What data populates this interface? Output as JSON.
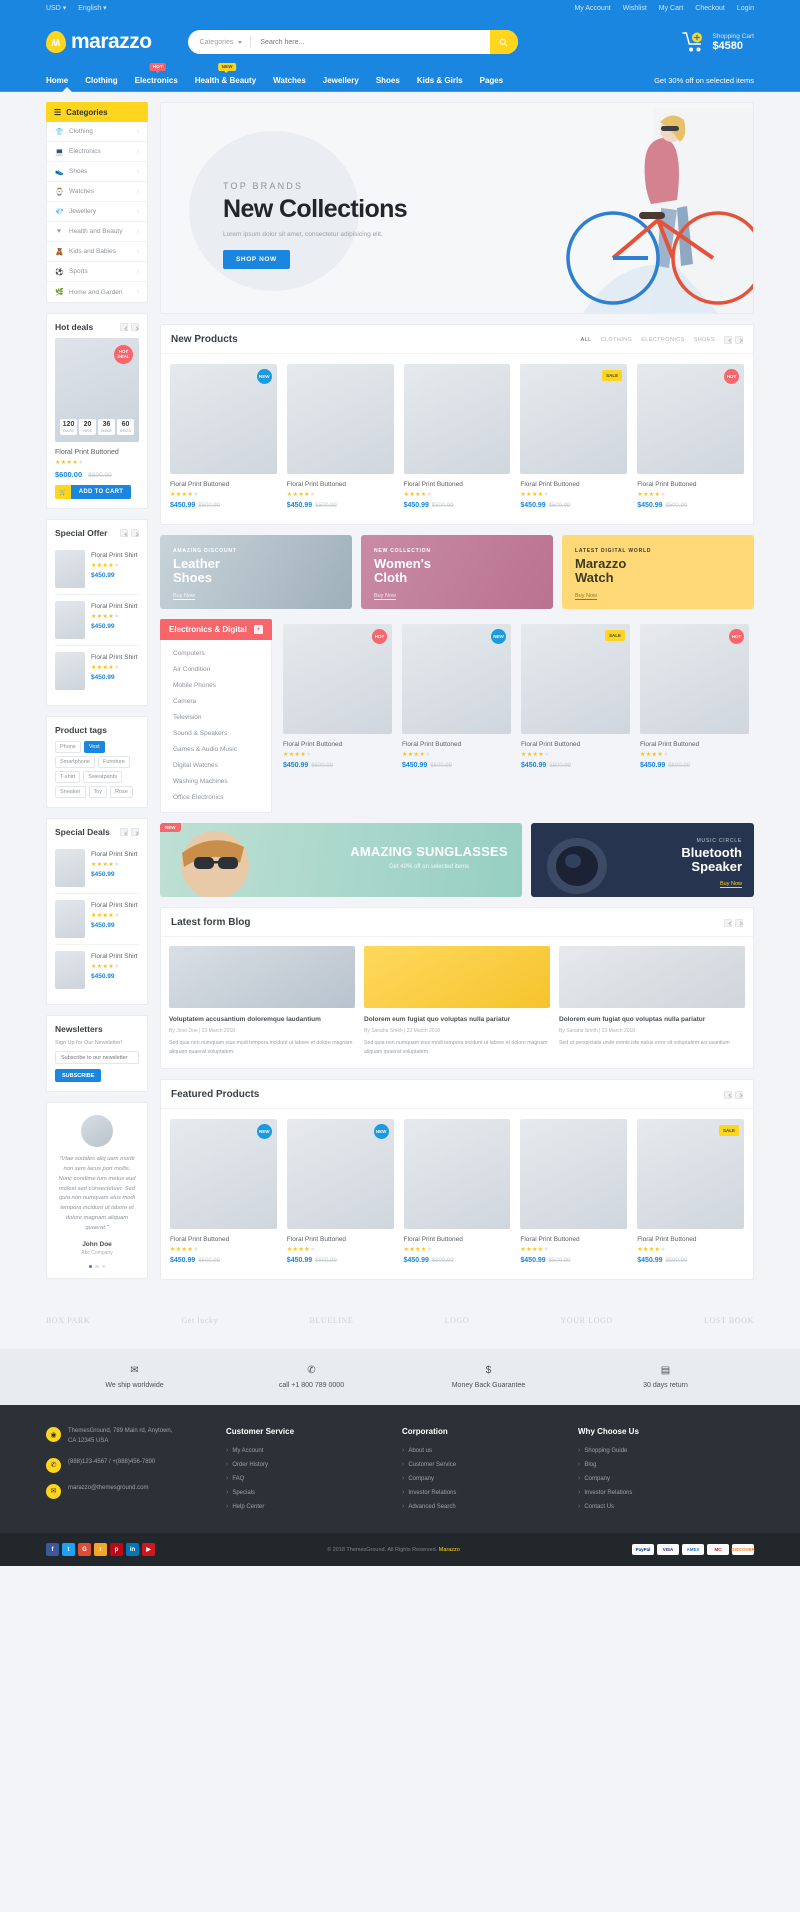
{
  "topbar": {
    "currency": "USD",
    "language": "English",
    "links": [
      "My Account",
      "Wishlist",
      "My Cart",
      "Checkout",
      "Login"
    ]
  },
  "header": {
    "brand": "marazzo",
    "search": {
      "category": "Categories",
      "placeholder": "Search here...",
      "value": ""
    },
    "cart": {
      "label": "Shopping Cart",
      "total": "$4580"
    }
  },
  "nav": {
    "items": [
      {
        "label": "Home",
        "badge": ""
      },
      {
        "label": "Clothing",
        "badge": ""
      },
      {
        "label": "Electronics",
        "badge": "HOT"
      },
      {
        "label": "Health & Beauty",
        "badge": "NEW"
      },
      {
        "label": "Watches",
        "badge": ""
      },
      {
        "label": "Jewellery",
        "badge": ""
      },
      {
        "label": "Shoes",
        "badge": ""
      },
      {
        "label": "Kids & Girls",
        "badge": ""
      },
      {
        "label": "Pages",
        "badge": ""
      }
    ],
    "promo": "Get 30% off on selected items"
  },
  "categories": {
    "title": "Categories",
    "items": [
      {
        "label": "Clothing",
        "icon": "shirt-icon"
      },
      {
        "label": "Electronics",
        "icon": "laptop-icon"
      },
      {
        "label": "Shoes",
        "icon": "shoe-icon"
      },
      {
        "label": "Watches",
        "icon": "watch-icon"
      },
      {
        "label": "Jewellery",
        "icon": "diamond-icon"
      },
      {
        "label": "Health and Beauty",
        "icon": "heart-icon"
      },
      {
        "label": "Kids and Babies",
        "icon": "kids-icon"
      },
      {
        "label": "Sports",
        "icon": "ball-icon"
      },
      {
        "label": "Home and Garden",
        "icon": "leaf-icon"
      }
    ]
  },
  "hero": {
    "kicker": "TOP BRANDS",
    "heading": "New Collections",
    "subtitle": "Lorem ipsum dolor sit amet, consectetur adipisicing elit.",
    "button": "SHOP NOW"
  },
  "hot_deals": {
    "title": "Hot deals",
    "badge_line1": "HOT",
    "badge_line2": "DEAL",
    "countdown": [
      {
        "num": "120",
        "label": "DAYS"
      },
      {
        "num": "20",
        "label": "HRS"
      },
      {
        "num": "36",
        "label": "MINS"
      },
      {
        "num": "60",
        "label": "SECS"
      }
    ],
    "product": {
      "name": "Floral Print Buttoned",
      "rating": 4,
      "price": "$600.00",
      "old_price": "$800.00"
    },
    "add_to_cart": "ADD TO CART"
  },
  "special_offer": {
    "title": "Special Offer",
    "items": [
      {
        "name": "Floral Print Shirt",
        "price": "$450.99",
        "rating": 4
      },
      {
        "name": "Floral Print Shirt",
        "price": "$450.99",
        "rating": 4
      },
      {
        "name": "Floral Print Shirt",
        "price": "$450.99",
        "rating": 4
      }
    ]
  },
  "product_tags": {
    "title": "Product tags",
    "tags": [
      {
        "label": "Phone",
        "active": false
      },
      {
        "label": "Vest",
        "active": true
      },
      {
        "label": "Smartphone",
        "active": false
      },
      {
        "label": "Furniture",
        "active": false
      },
      {
        "label": "T-shirt",
        "active": false
      },
      {
        "label": "Sweatpants",
        "active": false
      },
      {
        "label": "Sneaker",
        "active": false
      },
      {
        "label": "Toy",
        "active": false
      },
      {
        "label": "Rose",
        "active": false
      }
    ]
  },
  "special_deals": {
    "title": "Special Deals",
    "items": [
      {
        "name": "Floral Print Shirt",
        "price": "$450.99",
        "rating": 4
      },
      {
        "name": "Floral Print Shirt",
        "price": "$450.99",
        "rating": 4
      },
      {
        "name": "Floral Print Shirt",
        "price": "$450.99",
        "rating": 4
      }
    ]
  },
  "newsletter": {
    "title": "Newsletters",
    "subtitle": "Sign Up for Our Newsletter!",
    "placeholder": "Subscribe to our newsletter",
    "button": "SUBSCRIBE"
  },
  "testimonial": {
    "quote": "\"Vtae sodales aliq uam morbi non sem lacus port mollis. Nunc condime tum metus eud molest sed consectetuer. Sed quia non numquam eius modi tempora incidunt ut labore et dolore magnam aliquam quaerat.\"",
    "name": "John Doe",
    "company": "Abc Company"
  },
  "new_products": {
    "title": "New Products",
    "filters": [
      {
        "label": "ALL",
        "active": true
      },
      {
        "label": "CLOTHING",
        "active": false
      },
      {
        "label": "ELECTRONICS",
        "active": false
      },
      {
        "label": "SHOES",
        "active": false
      }
    ],
    "items": [
      {
        "name": "Floral Print Buttoned",
        "price": "$450.99",
        "old_price": "$500.99",
        "rating": 4,
        "badge": "NEW",
        "badge_type": "new"
      },
      {
        "name": "Floral Print Buttoned",
        "price": "$450.99",
        "old_price": "$500.99",
        "rating": 4,
        "badge": "",
        "badge_type": ""
      },
      {
        "name": "Floral Print Buttoned",
        "price": "$450.99",
        "old_price": "$500.99",
        "rating": 4,
        "badge": "",
        "badge_type": ""
      },
      {
        "name": "Floral Print Buttoned",
        "price": "$450.99",
        "old_price": "$500.99",
        "rating": 4,
        "badge": "SALE",
        "badge_type": "sale"
      },
      {
        "name": "Floral Print Buttoned",
        "price": "$450.99",
        "old_price": "$500.99",
        "rating": 4,
        "badge": "HOT",
        "badge_type": "hot"
      }
    ]
  },
  "promos": [
    {
      "kicker": "AMAZING DISCOUNT",
      "heading": "Leather\nShoes",
      "link": "Buy Now"
    },
    {
      "kicker": "NEW COLLECTION",
      "heading": "Women's\nCloth",
      "link": "Buy Now"
    },
    {
      "kicker": "LATEST DIGITAL WORLD",
      "heading": "Marazzo\nWatch",
      "link": "Buy Now"
    }
  ],
  "electronics": {
    "tab": "Electronics & Digital",
    "menu": [
      "Computers",
      "Air Condition",
      "Mobile Phones",
      "Camera",
      "Television",
      "Sound & Speakers",
      "Games & Audio Music",
      "Digital Watches",
      "Washing Machines",
      "Office Electronics"
    ],
    "items": [
      {
        "name": "Floral Print Buttoned",
        "price": "$450.99",
        "old_price": "$500.99",
        "rating": 4,
        "badge": "HOT",
        "badge_type": "hot"
      },
      {
        "name": "Floral Print Buttoned",
        "price": "$450.99",
        "old_price": "$500.99",
        "rating": 4,
        "badge": "NEW",
        "badge_type": "new"
      },
      {
        "name": "Floral Print Buttoned",
        "price": "$450.99",
        "old_price": "$500.99",
        "rating": 4,
        "badge": "SALE",
        "badge_type": "sale"
      },
      {
        "name": "Floral Print Buttoned",
        "price": "$450.99",
        "old_price": "$500.99",
        "rating": 4,
        "badge": "HOT",
        "badge_type": "hot"
      }
    ]
  },
  "wide_banners": {
    "left": {
      "tag": "NEW",
      "heading": "AMAZING SUNGLASSES",
      "subtitle": "Get 40% off on selected items"
    },
    "right": {
      "kicker": "MUSIC CIRCLE",
      "heading": "Bluetooth\nSpeaker",
      "link": "Buy Now"
    }
  },
  "blog": {
    "title": "Latest form Blog",
    "posts": [
      {
        "title": "Voluptatem accusantium doloremque laudantium",
        "meta": "By Jone Doe | 23 March 2018",
        "excerpt": "Sed quia non numquam eius modi tempora incidunt ut labore et dolore magnam aliquam quaerat voluptatem."
      },
      {
        "title": "Dolorem eum fugiat quo voluptas nulla pariatur",
        "meta": "By Sanaha Smith | 23 March 2018",
        "excerpt": "Sed quia non numquam eius modi tempora incidunt ut labore et dolore magnam aliquam quaerat voluptatem."
      },
      {
        "title": "Dolorem eum fugiat quo voluptas nulla pariatur",
        "meta": "By Sanaha Smith | 23 March 2018",
        "excerpt": "Sed ut perspiciatis unde omnis iste natus error sit voluptatem accusantium"
      }
    ]
  },
  "featured": {
    "title": "Featured Products",
    "items": [
      {
        "name": "Floral Print Buttoned",
        "price": "$450.99",
        "old_price": "$500.99",
        "rating": 4,
        "badge": "NEW",
        "badge_type": "new"
      },
      {
        "name": "Floral Print Buttoned",
        "price": "$450.99",
        "old_price": "$500.99",
        "rating": 4,
        "badge": "NEW",
        "badge_type": "new"
      },
      {
        "name": "Floral Print Buttoned",
        "price": "$450.99",
        "old_price": "$500.99",
        "rating": 4,
        "badge": "",
        "badge_type": ""
      },
      {
        "name": "Floral Print Buttoned",
        "price": "$450.99",
        "old_price": "$500.99",
        "rating": 4,
        "badge": "",
        "badge_type": ""
      },
      {
        "name": "Floral Print Buttoned",
        "price": "$450.99",
        "old_price": "$500.99",
        "rating": 4,
        "badge": "SALE",
        "badge_type": "sale"
      }
    ]
  },
  "brands": [
    "BOX PARK",
    "Get lucky",
    "BLUELINE",
    "LOGO",
    "YOUR LOGO",
    "LOST BOOK"
  ],
  "services": [
    {
      "icon": "truck-icon",
      "glyph": "✉",
      "text": "We ship worldwide"
    },
    {
      "icon": "phone-icon",
      "glyph": "✆",
      "text": "call +1 800 789 0000"
    },
    {
      "icon": "dollar-icon",
      "glyph": "$",
      "text": "Money Back Guarantee"
    },
    {
      "icon": "calendar-icon",
      "glyph": "▤",
      "text": "30 days return"
    }
  ],
  "footer": {
    "contact": [
      {
        "icon": "location-icon",
        "glyph": "◉",
        "text": "ThemesGround, 789 Main rd, Anytown,\nCA 12345 USA"
      },
      {
        "icon": "phone-icon",
        "glyph": "✆",
        "text": "(888)123-4567 / +(888)456-7890"
      },
      {
        "icon": "mail-icon",
        "glyph": "✉",
        "text": "marazzo@themesground.com"
      }
    ],
    "columns": [
      {
        "heading": "Customer Service",
        "links": [
          "My Account",
          "Order History",
          "FAQ",
          "Specials",
          "Help Center"
        ]
      },
      {
        "heading": "Corporation",
        "links": [
          "About us",
          "Customer Service",
          "Company",
          "Investor Relations",
          "Advanced Search"
        ]
      },
      {
        "heading": "Why Choose Us",
        "links": [
          "Shopping Guide",
          "Blog",
          "Company",
          "Investor Relations",
          "Contact Us"
        ]
      }
    ],
    "socials": [
      {
        "name": "facebook-icon",
        "glyph": "f",
        "color": "#3b5998"
      },
      {
        "name": "twitter-icon",
        "glyph": "t",
        "color": "#1da1f2"
      },
      {
        "name": "google-plus-icon",
        "glyph": "G",
        "color": "#dd4b39"
      },
      {
        "name": "rss-icon",
        "glyph": "r",
        "color": "#f5a623"
      },
      {
        "name": "pinterest-icon",
        "glyph": "p",
        "color": "#bd081c"
      },
      {
        "name": "linkedin-icon",
        "glyph": "in",
        "color": "#0077b5"
      },
      {
        "name": "youtube-icon",
        "glyph": "▶",
        "color": "#cc181e"
      }
    ],
    "copyright_pre": "© 2018 ThemesGround. All Rights Reserved.",
    "copyright_link": "Marazzo",
    "payments": [
      "PayPal",
      "VISA",
      "AMEX",
      "MC",
      "DISCOVER"
    ]
  }
}
